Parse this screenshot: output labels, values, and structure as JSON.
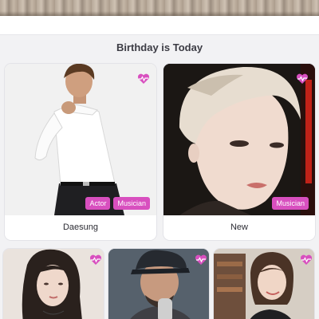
{
  "section": {
    "title": "Birthday is Today"
  },
  "cards": [
    {
      "name": "Daesung",
      "tags": [
        "Actor",
        "Musician"
      ]
    },
    {
      "name": "New",
      "tags": [
        "Musician"
      ]
    },
    {
      "name": "",
      "tags": []
    },
    {
      "name": "",
      "tags": []
    },
    {
      "name": "",
      "tags": []
    }
  ],
  "colors": {
    "accent": "#d84fbf",
    "heart": "#d84fbf"
  },
  "icons": {
    "card_badge": "heart-pulse-icon"
  }
}
